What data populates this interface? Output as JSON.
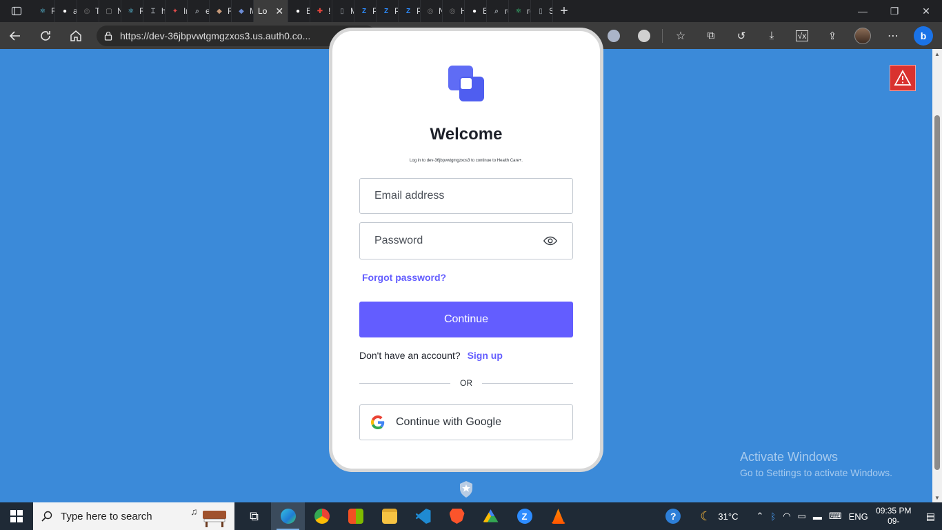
{
  "browser": {
    "tabs": [
      {
        "label": "Re",
        "color": "#61dafb",
        "glyph": "⚛"
      },
      {
        "label": "as",
        "color": "#ffffff",
        "glyph": "●"
      },
      {
        "label": "Ta",
        "color": "#7a7a7a",
        "glyph": "◎"
      },
      {
        "label": "Nı",
        "color": "#8a8a8a",
        "glyph": "▢"
      },
      {
        "label": "Re",
        "color": "#61dafb",
        "glyph": "⚛"
      },
      {
        "label": "ht",
        "color": "#9aa0a6",
        "glyph": "⌶"
      },
      {
        "label": "In",
        "color": "#e04b4b",
        "glyph": "✦"
      },
      {
        "label": "er",
        "color": "#9aa0a6",
        "glyph": "⌕"
      },
      {
        "label": "Re",
        "color": "#c79a7a",
        "glyph": "◆"
      },
      {
        "label": "M",
        "color": "#6c8cd5",
        "glyph": "◆"
      },
      {
        "label": "Lo",
        "color": "#000000",
        "glyph": "",
        "active": true
      },
      {
        "label": "Ec",
        "color": "#ffffff",
        "glyph": "●"
      },
      {
        "label": "! S",
        "color": "#e8453c",
        "glyph": "✚"
      },
      {
        "label": "M",
        "color": "#9aa0a6",
        "glyph": "▯"
      },
      {
        "label": "Pc",
        "color": "#2d8cff",
        "glyph": "Z"
      },
      {
        "label": "Pc",
        "color": "#2d8cff",
        "glyph": "Z"
      },
      {
        "label": "Pc",
        "color": "#2d8cff",
        "glyph": "Z"
      },
      {
        "label": "Nı",
        "color": "#7a7a7a",
        "glyph": "◎"
      },
      {
        "label": "Hı",
        "color": "#7a7a7a",
        "glyph": "◎"
      },
      {
        "label": "Ec",
        "color": "#ffffff",
        "glyph": "●"
      },
      {
        "label": "re",
        "color": "#9aa0a6",
        "glyph": "⌕"
      },
      {
        "label": "re",
        "color": "#3ddc84",
        "glyph": "⚛"
      },
      {
        "label": "Sc",
        "color": "#9aa0a6",
        "glyph": "▯"
      }
    ],
    "url": "https://dev-36jbpvwtgmgzxos3.us.auth0.co...",
    "extensions": [
      "#1a73e8",
      "#e94235",
      "#bbbbbb",
      "#ffffff",
      "#61dafb",
      "#cccccc",
      "#15c39a",
      "#aab4c8",
      "#d0d0d0"
    ]
  },
  "login": {
    "title": "Welcome",
    "subtitle": "Log in to dev-36jbpvwtgmgzxos3 to continue to Health Care+.",
    "email_placeholder": "Email address",
    "password_placeholder": "Password",
    "forgot": "Forgot password?",
    "continue": "Continue",
    "no_account": "Don't have an account?",
    "signup": "Sign up",
    "or": "OR",
    "google": "Continue with Google",
    "brand_color": "#635dff"
  },
  "watermark": {
    "line1": "Activate Windows",
    "line2": "Go to Settings to activate Windows."
  },
  "taskbar": {
    "search_placeholder": "Type here to search",
    "weather": "31°C",
    "language": "ENG",
    "time": "09:35 PM",
    "date": "09-"
  }
}
